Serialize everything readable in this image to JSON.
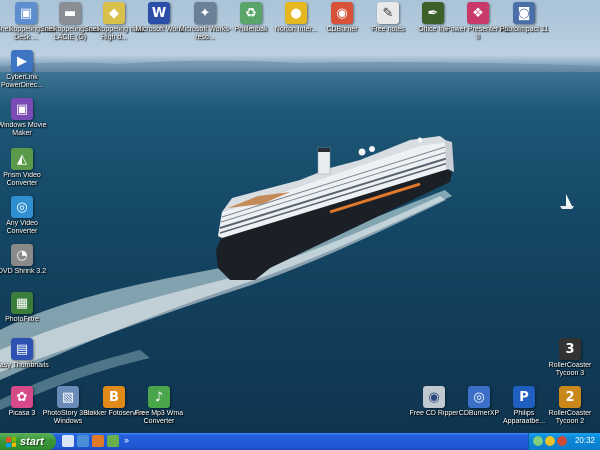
{
  "desktop": {
    "icons_top": [
      {
        "name": "icon-snelkoppeling-desk",
        "label": "Snelkoppeling naar Desk ...",
        "color": "#5d8fd0",
        "glyph": "▣",
        "icon": "computer-icon"
      },
      {
        "name": "icon-snelkoppeling-lacie",
        "label": "Snelkoppeling naar LACIE (G)",
        "color": "#8a8f96",
        "glyph": "▬",
        "icon": "drive-icon"
      },
      {
        "name": "icon-snelkoppeling-high",
        "label": "Snelkoppeling naar High d...",
        "color": "#d9c04a",
        "glyph": "◆",
        "icon": "folder-icon"
      },
      {
        "name": "icon-microsoft-word",
        "label": "Microsoft Word",
        "color": "#2b4fa8",
        "glyph": "W",
        "icon": "word-icon"
      },
      {
        "name": "icon-microsoft-works",
        "label": "Microsoft Works-reso...",
        "color": "#6b7f99",
        "glyph": "✦",
        "icon": "works-icon"
      },
      {
        "name": "icon-prullenbak",
        "label": "Prullenbak",
        "color": "#5aa66a",
        "glyph": "♻",
        "icon": "recycle-bin-icon"
      },
      {
        "name": "icon-norton-internet",
        "label": "Norton Inter...",
        "color": "#e5b821",
        "glyph": "●",
        "icon": "norton-icon"
      },
      {
        "name": "icon-cdburner",
        "label": "CDBurner",
        "color": "#d8523a",
        "glyph": "◉",
        "icon": "cdburner-icon"
      },
      {
        "name": "icon-free-notes",
        "label": "Free notes",
        "color": "#e8e8e8",
        "glyph": "✎",
        "icon": "notes-icon"
      },
      {
        "name": "icon-office-ink",
        "label": "Office Ink",
        "color": "#3d5f2a",
        "glyph": "✒",
        "icon": "office-ink-icon"
      },
      {
        "name": "icon-power-presenter",
        "label": "Power Presenter RE II",
        "color": "#c93a6b",
        "glyph": "❖",
        "icon": "presenter-icon"
      },
      {
        "name": "icon-photoimpact",
        "label": "PhotoImpact 11",
        "color": "#4a6fa8",
        "glyph": "◙",
        "icon": "photoimpact-icon"
      }
    ],
    "icons_left": [
      {
        "name": "icon-cyberlink",
        "label": "CyberLink PowerDirec...",
        "color": "#3e74c4",
        "glyph": "▶",
        "icon": "cyberlink-icon"
      },
      {
        "name": "icon-windows-movie-maker",
        "label": "Windows Movie Maker",
        "color": "#7a4bb5",
        "glyph": "🎞",
        "icon": "movie-maker-icon"
      },
      {
        "name": "icon-prism-video",
        "label": "Prism Video Converter",
        "color": "#5b9a4a",
        "glyph": "◭",
        "icon": "prism-icon"
      },
      {
        "name": "icon-any-video",
        "label": "Any Video Converter",
        "color": "#2f8fd0",
        "glyph": "◎",
        "icon": "any-video-icon"
      },
      {
        "name": "icon-dvd-shrink",
        "label": "DVD Shrink 3.2",
        "color": "#8a8a8a",
        "glyph": "◔",
        "icon": "dvd-icon"
      },
      {
        "name": "icon-photofiltre",
        "label": "PhotoFiltre",
        "color": "#3b7d3b",
        "glyph": "▦",
        "icon": "photofiltre-icon"
      },
      {
        "name": "icon-easy-thumbnails",
        "label": "Easy Thumbnails",
        "color": "#2d52b3",
        "glyph": "▤",
        "icon": "thumbnails-icon"
      },
      {
        "name": "icon-picasa",
        "label": "Picasa 3",
        "color": "#d64a8a",
        "glyph": "✿",
        "icon": "picasa-icon"
      }
    ],
    "icons_bottom": [
      {
        "name": "icon-photostory",
        "label": "PhotoStory 3 for Windows",
        "color": "#6a8ab8",
        "glyph": "▧",
        "icon": "photostory-icon"
      },
      {
        "name": "icon-blokker",
        "label": "Blokker Fotoservice",
        "color": "#e08a1a",
        "glyph": "B",
        "icon": "blokker-icon"
      },
      {
        "name": "icon-free-mp3-wma",
        "label": "Free Mp3 Wma Converter",
        "color": "#4aa64a",
        "glyph": "♪",
        "icon": "mp3-icon"
      },
      {
        "name": "icon-free-cd-ripper",
        "label": "Free CD Ripper",
        "color": "#c0c8d0",
        "glyph": "◉",
        "icon": "cd-ripper-icon"
      },
      {
        "name": "icon-cdburnerxp",
        "label": "CDBurnerXP",
        "color": "#3b6fc8",
        "glyph": "◎",
        "icon": "cdburnerxp-icon"
      },
      {
        "name": "icon-philips",
        "label": "Philips Apparaatbe...",
        "color": "#1f5fbf",
        "glyph": "P",
        "icon": "philips-icon"
      },
      {
        "name": "icon-rollercoaster-2",
        "label": "RollerCoaster Tycoon 2",
        "color": "#c8881a",
        "glyph": "2",
        "icon": "rollercoaster2-icon"
      }
    ],
    "icon_rollercoaster_3": {
      "name": "icon-rollercoaster-3",
      "label": "RollerCoaster Tycoon 3",
      "color": "#333333",
      "glyph": "3",
      "icon": "rollercoaster3-icon"
    }
  },
  "taskbar": {
    "start_label": "start",
    "clock": "20:32"
  }
}
